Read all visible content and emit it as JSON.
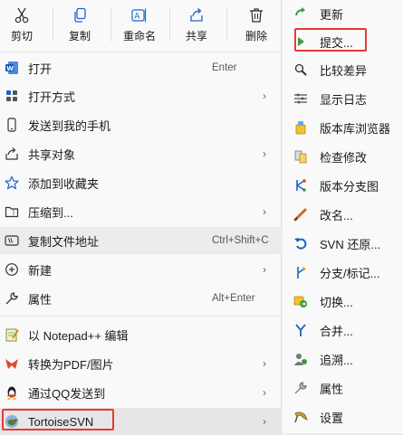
{
  "toolbar": [
    {
      "label": "剪切",
      "icon": "scissors-icon"
    },
    {
      "label": "复制",
      "icon": "copy-icon"
    },
    {
      "label": "重命名",
      "icon": "rename-icon"
    },
    {
      "label": "共享",
      "icon": "share-icon"
    },
    {
      "label": "删除",
      "icon": "trash-icon"
    }
  ],
  "menu": {
    "open": {
      "label": "打开",
      "shortcut": "Enter"
    },
    "open_with": {
      "label": "打开方式"
    },
    "send_to_phone": {
      "label": "发送到我的手机"
    },
    "share_with": {
      "label": "共享对象"
    },
    "add_favorites": {
      "label": "添加到收藏夹"
    },
    "compress": {
      "label": "压缩到..."
    },
    "copy_path": {
      "label": "复制文件地址",
      "shortcut": "Ctrl+Shift+C"
    },
    "new": {
      "label": "新建"
    },
    "properties": {
      "label": "属性",
      "shortcut": "Alt+Enter"
    },
    "notepadpp": {
      "label": "以 Notepad++ 编辑"
    },
    "to_pdf": {
      "label": "转换为PDF/图片"
    },
    "send_qq": {
      "label": "通过QQ发送到"
    },
    "tortoisesvn": {
      "label": "TortoiseSVN"
    }
  },
  "submenu": [
    {
      "label": "更新",
      "icon": "svn-update-icon"
    },
    {
      "label": "提交...",
      "icon": "svn-commit-icon"
    },
    {
      "label": "比较差异",
      "icon": "svn-diff-icon"
    },
    {
      "label": "显示日志",
      "icon": "svn-log-icon"
    },
    {
      "label": "版本库浏览器",
      "icon": "svn-repo-browser-icon"
    },
    {
      "label": "检查修改",
      "icon": "svn-check-modifications-icon"
    },
    {
      "label": "版本分支图",
      "icon": "svn-revision-graph-icon"
    },
    {
      "label": "改名...",
      "icon": "svn-rename-icon"
    },
    {
      "label": "SVN 还原...",
      "icon": "svn-revert-icon"
    },
    {
      "label": "分支/标记...",
      "icon": "svn-branch-tag-icon"
    },
    {
      "label": "切换...",
      "icon": "svn-switch-icon"
    },
    {
      "label": "合并...",
      "icon": "svn-merge-icon"
    },
    {
      "label": "追溯...",
      "icon": "svn-blame-icon"
    },
    {
      "label": "属性",
      "icon": "svn-properties-icon"
    },
    {
      "label": "设置",
      "icon": "svn-settings-icon"
    }
  ],
  "colors": {
    "highlight_box": "#e53935",
    "svn_green": "#3a9a3a",
    "accent_blue": "#1e63c9"
  }
}
